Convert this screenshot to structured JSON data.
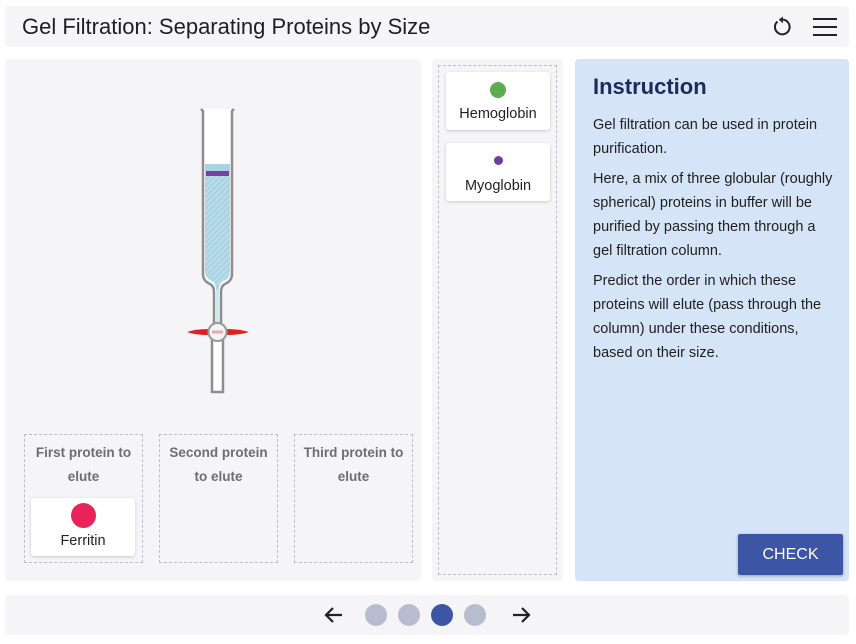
{
  "header": {
    "title": "Gel Filtration: Separating Proteins by Size",
    "reset_icon": "reset-icon",
    "menu_icon": "hamburger-menu-icon"
  },
  "drop_zones": [
    {
      "label": "First protein to elute"
    },
    {
      "label": "Second protein to elute"
    },
    {
      "label": "Third protein to elute"
    }
  ],
  "proteins": {
    "ferritin": {
      "label": "Ferritin",
      "color": "#e8255a"
    },
    "hemoglobin": {
      "label": "Hemoglobin",
      "color": "#5aae4e"
    },
    "myoglobin": {
      "label": "Myoglobin",
      "color": "#6d3f9c"
    }
  },
  "instruction": {
    "title": "Instruction",
    "paragraphs": [
      "Gel filtration can be used in protein purification.",
      "Here, a mix of three globular (roughly spherical) proteins in buffer will be purified by passing them through a gel filtration column.",
      "Predict the order in which these proteins will elute (pass through the column) under these conditions, based on their size."
    ],
    "check_label": "CHECK"
  },
  "pagination": {
    "prev_icon": "arrow-left-icon",
    "next_icon": "arrow-right-icon",
    "total_pages": 4,
    "current_page": 3
  },
  "colors": {
    "accent": "#3c55a5",
    "stopcock": "#e02020",
    "protein_band": "#7b3fa0",
    "dot_inactive": "#b8bccf",
    "dot_active": "#3c55a5"
  }
}
